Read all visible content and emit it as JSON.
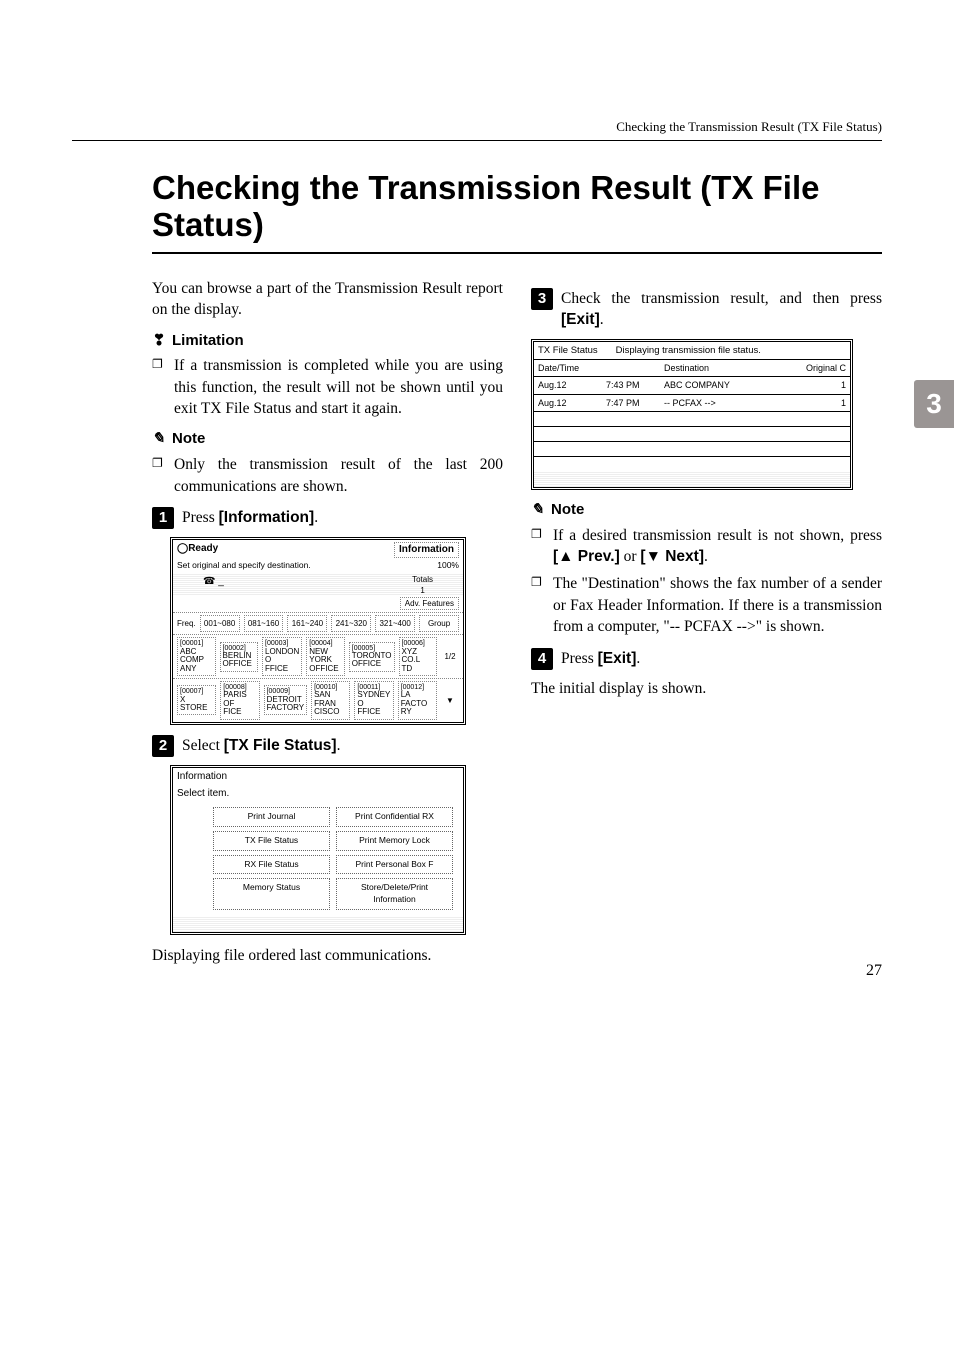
{
  "running_head": "Checking the Transmission Result (TX File Status)",
  "title": "Checking the Transmission Result (TX File Status)",
  "side_tab": "3",
  "page_number": "27",
  "intro": "You can browse a part of the Transmission Result report on the display.",
  "limitation_label": "Limitation",
  "limitation_item": "If a transmission is completed while you are using this function, the result will not be shown until you exit TX File Status and start it again.",
  "note_label": "Note",
  "note1_item": "Only the transmission result of the last 200 communications are shown.",
  "step1_pre": "Press ",
  "step1_btn": "[Information]",
  "step1_post": ".",
  "step2_pre": "Select ",
  "step2_btn": "[TX File Status]",
  "step2_post": ".",
  "after_step2": "Displaying file ordered last communications.",
  "step3_text_a": "Check the transmission result, and then press ",
  "step3_btn": "[Exit]",
  "step3_text_b": ".",
  "note2_item1_a": "If a desired transmission result is not shown, press ",
  "note2_item1_b": "[▲ Prev.]",
  "note2_item1_c": " or ",
  "note2_item1_d": "[▼ Next]",
  "note2_item1_e": ".",
  "note2_item2": "The \"Destination\" shows the fax number of a sender or Fax Header Information. If there is a transmission from a computer, \"-- PCFAX -->\" is shown.",
  "step4_pre": "Press ",
  "step4_btn": "[Exit]",
  "step4_post": ".",
  "after_step4": "The initial display is shown.",
  "fig1": {
    "ready": "Ready",
    "set_orig": "Set original and specify destination.",
    "info_btn": "Information",
    "pct": "100%",
    "totals": "Totals",
    "totals_val": "1",
    "adv": "Adv. Features",
    "freq": "Freq.",
    "ranges": [
      "001~080",
      "081~160",
      "161~240",
      "241~320",
      "321~400",
      "Group"
    ],
    "row1": [
      {
        "code": "[00001]",
        "l1": "ABC COMP",
        "l2": "ANY"
      },
      {
        "code": "[00002]",
        "l1": "BERLIN",
        "l2": "OFFICE"
      },
      {
        "code": "[00003]",
        "l1": "LONDON O",
        "l2": "FFICE"
      },
      {
        "code": "[00004]",
        "l1": "NEW YORK",
        "l2": "OFFICE"
      },
      {
        "code": "[00005]",
        "l1": "TORONTO",
        "l2": "OFFICE"
      },
      {
        "code": "[00006]",
        "l1": "XYZ CO.L",
        "l2": "TD"
      }
    ],
    "row2": [
      {
        "code": "[00007]",
        "l1": "X STORE",
        "l2": ""
      },
      {
        "code": "[00008]",
        "l1": "PARIS OF",
        "l2": "FICE"
      },
      {
        "code": "[00009]",
        "l1": "DETROIT",
        "l2": "FACTORY"
      },
      {
        "code": "[00010]",
        "l1": "SAN FRAN",
        "l2": "CISCO"
      },
      {
        "code": "[00011]",
        "l1": "SYDNEY O",
        "l2": "FFICE"
      },
      {
        "code": "[00012]",
        "l1": "LA FACTO",
        "l2": "RY"
      }
    ],
    "page_ind": "1/2"
  },
  "fig2": {
    "head1": "Information",
    "head2": "Select item.",
    "buttons": [
      [
        "Print Journal",
        "Print Confidential RX"
      ],
      [
        "TX File Status",
        "Print Memory Lock"
      ],
      [
        "RX File Status",
        "Print Personal Box F"
      ],
      [
        "Memory Status",
        "Store/Delete/Print Information"
      ]
    ]
  },
  "fig3": {
    "title_left": "TX File Status",
    "title_right": "Displaying transmission file status.",
    "h_date": "Date/Time",
    "h_dest": "Destination",
    "h_orig": "Original C",
    "rows": [
      {
        "date": "Aug.12",
        "time": "7:43 PM",
        "dest": "ABC COMPANY",
        "orig": "1"
      },
      {
        "date": "Aug.12",
        "time": "7:47 PM",
        "dest": "-- PCFAX -->",
        "orig": "1"
      }
    ]
  }
}
